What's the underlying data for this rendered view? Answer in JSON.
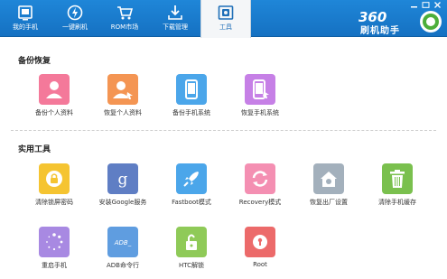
{
  "topbar": {
    "nav": [
      {
        "label": "我的手机",
        "icon": "my-phone-icon"
      },
      {
        "label": "一键刷机",
        "icon": "flash-icon"
      },
      {
        "label": "ROM市场",
        "icon": "cart-icon"
      },
      {
        "label": "下载管理",
        "icon": "download-icon"
      },
      {
        "label": "工具",
        "icon": "toolbox-icon",
        "active": true
      }
    ],
    "brand": {
      "number": "360",
      "text": "刷机助手"
    }
  },
  "backup": {
    "title": "备份恢复",
    "items": [
      {
        "label": "备份个人资料",
        "color": "#f4799a",
        "icon": "person-icon"
      },
      {
        "label": "恢复个人资料",
        "color": "#f49553",
        "icon": "person-restore-icon"
      },
      {
        "label": "备份手机系统",
        "color": "#4ba6ea",
        "icon": "phone-icon"
      },
      {
        "label": "恢复手机系统",
        "color": "#c680e6",
        "icon": "phone-restore-icon"
      }
    ]
  },
  "tools": {
    "title": "实用工具",
    "items": [
      {
        "label": "清除锁屏密码",
        "color": "#f5c431",
        "icon": "lock-icon"
      },
      {
        "label": "安装Google服务",
        "color": "#5f7ec4",
        "icon": "google-icon"
      },
      {
        "label": "Fastboot模式",
        "color": "#4ba6ea",
        "icon": "rocket-icon"
      },
      {
        "label": "Recovery模式",
        "color": "#f48fb2",
        "icon": "refresh-icon"
      },
      {
        "label": "恢复出厂设置",
        "color": "#a3b0bc",
        "icon": "home-gear-icon"
      },
      {
        "label": "清除手机缓存",
        "color": "#7ac04e",
        "icon": "trash-icon"
      },
      {
        "label": "重启手机",
        "color": "#a889e2",
        "icon": "spinner-icon"
      },
      {
        "label": "ADB命令行",
        "color": "#5f9de0",
        "icon": "adb-icon",
        "glyph": "ADB_"
      },
      {
        "label": "HTC解锁",
        "color": "#8fca58",
        "icon": "unlock-icon"
      },
      {
        "label": "Root",
        "color": "#ec6a6a",
        "icon": "root-icon"
      }
    ]
  }
}
